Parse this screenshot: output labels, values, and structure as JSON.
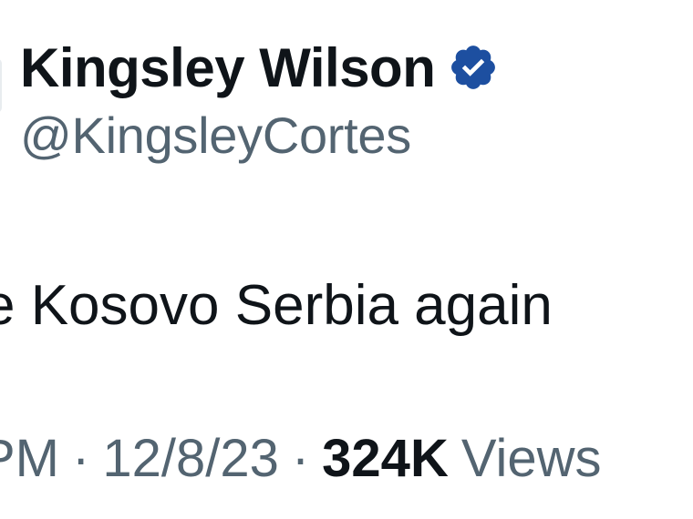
{
  "author": {
    "display_name": "Kingsley Wilson",
    "handle": "@KingsleyCortes",
    "verified_icon": "verified-badge-icon",
    "badge_color": "#1d4fa0"
  },
  "tweet": {
    "text_visible": "e Kosovo Serbia again"
  },
  "meta": {
    "time_partial": "PM",
    "separator": "·",
    "date": "12/8/23",
    "views_count": "324K",
    "views_label": "Views"
  },
  "colors": {
    "primary_text": "#0f1419",
    "secondary_text": "#536471",
    "background": "#ffffff"
  }
}
